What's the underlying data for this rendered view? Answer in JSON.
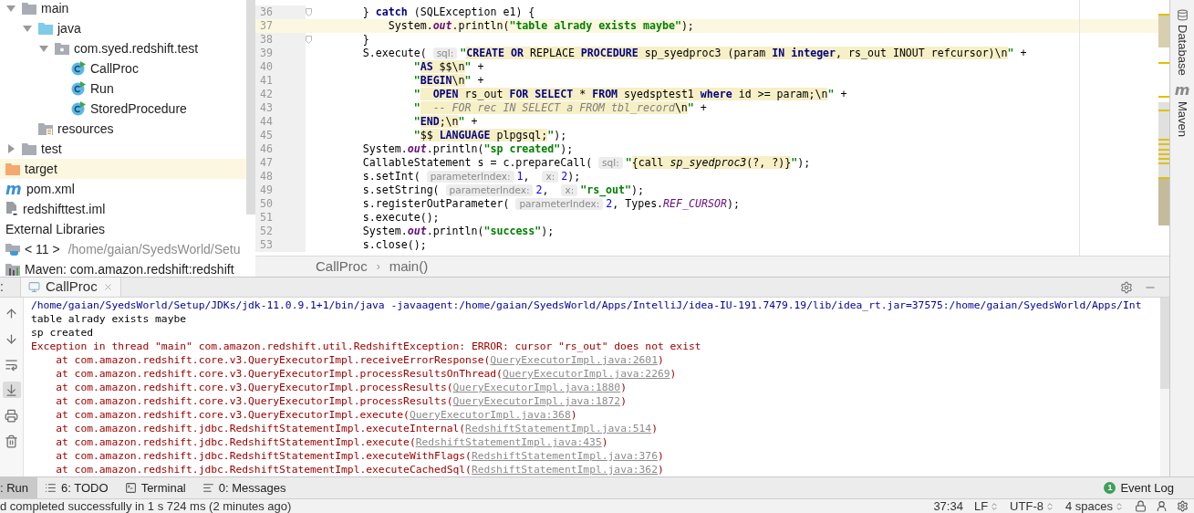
{
  "project_tree": [
    {
      "label": "main",
      "kind": "folder",
      "expanded": true,
      "selected": false,
      "children": [
        {
          "label": "java",
          "kind": "source_folder",
          "expanded": true,
          "selected": false,
          "children": [
            {
              "label": "com.syed.redshift.test",
              "kind": "package",
              "expanded": true,
              "selected": false,
              "children": [
                {
                  "label": "CallProc",
                  "kind": "class",
                  "selected": false
                },
                {
                  "label": "Run",
                  "kind": "class",
                  "selected": false
                },
                {
                  "label": "StoredProcedure",
                  "kind": "class",
                  "selected": false
                }
              ]
            }
          ]
        },
        {
          "label": "resources",
          "kind": "resources",
          "selected": false
        }
      ]
    },
    {
      "label": "test",
      "kind": "folder",
      "expanded": false,
      "selected": false
    },
    {
      "label": "target",
      "kind": "excluded_folder",
      "selected": true
    },
    {
      "label": "pom.xml",
      "kind": "maven_file",
      "glyph": "m",
      "selected": false
    },
    {
      "label": "redshifttest.iml",
      "kind": "module_file",
      "selected": false
    },
    {
      "label": "External Libraries",
      "kind": "libraries",
      "selected": false
    },
    {
      "label": "< 11 >",
      "detail": "/home/gaian/SyedsWorld/Setu",
      "kind": "jdk",
      "selected": false
    },
    {
      "label": "Maven: com.amazon.redshift:redshift",
      "kind": "library",
      "selected": false
    }
  ],
  "editor": {
    "lines": [
      {
        "number": "36",
        "fold": true,
        "current": false,
        "tokens": [
          {
            "kind": "p",
            "text": "        } "
          },
          {
            "kind": "kw",
            "text": "catch"
          },
          {
            "kind": "p",
            "text": " (SQLException e1) {"
          }
        ]
      },
      {
        "number": "37",
        "fold": false,
        "current": true,
        "tokens": [
          {
            "kind": "p",
            "text": "            System."
          },
          {
            "kind": "f",
            "text": "out"
          },
          {
            "kind": "p",
            "text": ".println("
          },
          {
            "kind": "s",
            "text": "\"table alrady exists maybe\""
          },
          {
            "kind": "p",
            "text": ");"
          }
        ]
      },
      {
        "number": "38",
        "fold": true,
        "current": false,
        "tokens": [
          {
            "kind": "p",
            "text": "        }"
          }
        ]
      },
      {
        "number": "39",
        "fold": false,
        "current": false,
        "tokens": [
          {
            "kind": "p",
            "text": "        S.execute( "
          },
          {
            "kind": "h",
            "text": "sql:"
          },
          {
            "kind": "s",
            "text": "\""
          },
          {
            "kind": "sk",
            "text": "CREATE OR"
          },
          {
            "kind": "st",
            "text": " REPLACE "
          },
          {
            "kind": "sk",
            "text": "PROCEDURE"
          },
          {
            "kind": "st",
            "text": " sp_syedproc3 (param "
          },
          {
            "kind": "sk",
            "text": "IN integer"
          },
          {
            "kind": "st",
            "text": ", rs_out INOUT refcursor)\\n"
          },
          {
            "kind": "s",
            "text": "\""
          },
          {
            "kind": "p",
            "text": " +"
          }
        ]
      },
      {
        "number": "40",
        "fold": false,
        "current": false,
        "tokens": [
          {
            "kind": "s",
            "text": "                \""
          },
          {
            "kind": "sk",
            "text": "AS"
          },
          {
            "kind": "st",
            "text": " $$\\n"
          },
          {
            "kind": "s",
            "text": "\""
          },
          {
            "kind": "p",
            "text": " +"
          }
        ]
      },
      {
        "number": "41",
        "fold": false,
        "current": false,
        "tokens": [
          {
            "kind": "s",
            "text": "                \""
          },
          {
            "kind": "sk",
            "text": "BEGIN"
          },
          {
            "kind": "st",
            "text": "\\n"
          },
          {
            "kind": "s",
            "text": "\""
          },
          {
            "kind": "p",
            "text": " +"
          }
        ]
      },
      {
        "number": "42",
        "fold": false,
        "current": false,
        "tokens": [
          {
            "kind": "s",
            "text": "                \""
          },
          {
            "kind": "sk",
            "text": "  OPEN"
          },
          {
            "kind": "st",
            "text": " rs_out "
          },
          {
            "kind": "sk",
            "text": "FOR SELECT"
          },
          {
            "kind": "st",
            "text": " * "
          },
          {
            "kind": "sk",
            "text": "FROM"
          },
          {
            "kind": "st",
            "text": " syedsptest1 "
          },
          {
            "kind": "sk",
            "text": "where"
          },
          {
            "kind": "st",
            "text": " id >= param;\\n"
          },
          {
            "kind": "s",
            "text": "\""
          },
          {
            "kind": "p",
            "text": " +"
          }
        ]
      },
      {
        "number": "43",
        "fold": false,
        "current": false,
        "tokens": [
          {
            "kind": "s",
            "text": "                \""
          },
          {
            "kind": "sc",
            "text": "  -- FOR rec IN SELECT a FROM tbl_record"
          },
          {
            "kind": "st",
            "text": "\\n"
          },
          {
            "kind": "s",
            "text": "\""
          },
          {
            "kind": "p",
            "text": " +"
          }
        ]
      },
      {
        "number": "44",
        "fold": false,
        "current": false,
        "tokens": [
          {
            "kind": "s",
            "text": "                \""
          },
          {
            "kind": "sk",
            "text": "END"
          },
          {
            "kind": "st",
            "text": ";\\n"
          },
          {
            "kind": "s",
            "text": "\""
          },
          {
            "kind": "p",
            "text": " +"
          }
        ]
      },
      {
        "number": "45",
        "fold": false,
        "current": false,
        "tokens": [
          {
            "kind": "s",
            "text": "                \""
          },
          {
            "kind": "st",
            "text": "$$ "
          },
          {
            "kind": "sk",
            "text": "LANGUAGE"
          },
          {
            "kind": "st",
            "text": " plpgsql;"
          },
          {
            "kind": "s",
            "text": "\""
          },
          {
            "kind": "p",
            "text": ");"
          }
        ]
      },
      {
        "number": "46",
        "fold": false,
        "current": false,
        "tokens": [
          {
            "kind": "p",
            "text": "        System."
          },
          {
            "kind": "f",
            "text": "out"
          },
          {
            "kind": "p",
            "text": ".println("
          },
          {
            "kind": "s",
            "text": "\"sp created\""
          },
          {
            "kind": "p",
            "text": ");"
          }
        ]
      },
      {
        "number": "47",
        "fold": false,
        "current": false,
        "tokens": [
          {
            "kind": "p",
            "text": "        CallableStatement s = c.prepareCall( "
          },
          {
            "kind": "h",
            "text": "sql:"
          },
          {
            "kind": "s",
            "text": "\""
          },
          {
            "kind": "st",
            "text": "{call "
          },
          {
            "kind": "si",
            "text": "sp_syedproc3"
          },
          {
            "kind": "st",
            "text": "(?, ?)}"
          },
          {
            "kind": "s",
            "text": "\""
          },
          {
            "kind": "p",
            "text": ");"
          }
        ]
      },
      {
        "number": "48",
        "fold": false,
        "current": false,
        "tokens": [
          {
            "kind": "p",
            "text": "        s.setInt( "
          },
          {
            "kind": "h",
            "text": "parameterIndex:"
          },
          {
            "kind": "n",
            "text": "1"
          },
          {
            "kind": "p",
            "text": ",  "
          },
          {
            "kind": "h",
            "text": "x:"
          },
          {
            "kind": "n",
            "text": "2"
          },
          {
            "kind": "p",
            "text": ");"
          }
        ]
      },
      {
        "number": "49",
        "fold": false,
        "current": false,
        "tokens": [
          {
            "kind": "p",
            "text": "        s.setString( "
          },
          {
            "kind": "h",
            "text": "parameterIndex:"
          },
          {
            "kind": "n",
            "text": "2"
          },
          {
            "kind": "p",
            "text": ",  "
          },
          {
            "kind": "h",
            "text": "x:"
          },
          {
            "kind": "s",
            "text": "\"rs_out\""
          },
          {
            "kind": "p",
            "text": ");"
          }
        ]
      },
      {
        "number": "50",
        "fold": false,
        "current": false,
        "tokens": [
          {
            "kind": "p",
            "text": "        s.registerOutParameter( "
          },
          {
            "kind": "h",
            "text": "parameterIndex:"
          },
          {
            "kind": "n",
            "text": "2"
          },
          {
            "kind": "p",
            "text": ", Types."
          },
          {
            "kind": "c",
            "text": "REF_CURSOR"
          },
          {
            "kind": "p",
            "text": ");"
          }
        ]
      },
      {
        "number": "51",
        "fold": false,
        "current": false,
        "tokens": [
          {
            "kind": "p",
            "text": "        s.execute();"
          }
        ]
      },
      {
        "number": "52",
        "fold": false,
        "current": false,
        "tokens": [
          {
            "kind": "p",
            "text": "        System."
          },
          {
            "kind": "f",
            "text": "out"
          },
          {
            "kind": "p",
            "text": ".println("
          },
          {
            "kind": "s",
            "text": "\"success\""
          },
          {
            "kind": "p",
            "text": ");"
          }
        ]
      },
      {
        "number": "53",
        "fold": false,
        "current": false,
        "tokens": [
          {
            "kind": "p",
            "text": "        s.close();"
          }
        ]
      }
    ],
    "breadcrumbs": [
      "CallProc",
      "main()"
    ],
    "breadcrumb_separator": "›"
  },
  "right_toolbar": [
    {
      "label": "Database",
      "kind": "database"
    },
    {
      "label": "Maven",
      "kind": "maven",
      "glyph": "m"
    }
  ],
  "run_panel": {
    "label": ":",
    "tabs": [
      {
        "label": "CallProc",
        "selected": true
      }
    ],
    "toolbar": [
      {
        "kind": "up",
        "selected": false
      },
      {
        "kind": "down",
        "selected": false
      },
      {
        "kind": "wrap",
        "selected": false
      },
      {
        "kind": "scroll_end",
        "selected": true
      },
      {
        "kind": "print",
        "selected": false
      },
      {
        "kind": "trash",
        "selected": false
      }
    ],
    "console": [
      {
        "kind": "command",
        "text": "/home/gaian/SyedsWorld/Setup/JDKs/jdk-11.0.9.1+1/bin/java -javaagent:/home/gaian/SyedsWorld/Apps/IntelliJ/idea-IU-191.7479.19/lib/idea_rt.jar=37575:/home/gaian/SyedsWorld/Apps/Int"
      },
      {
        "kind": "out",
        "text": "table alrady exists maybe"
      },
      {
        "kind": "out",
        "text": "sp created"
      },
      {
        "kind": "error",
        "text": "Exception in thread \"main\" com.amazon.redshift.util.RedshiftException: ERROR: cursor \"rs_out\" does not exist"
      },
      {
        "kind": "trace",
        "text": "    at com.amazon.redshift.core.v3.QueryExecutorImpl.receiveErrorResponse(",
        "link": "QueryExecutorImpl.java:2601",
        "end": ")"
      },
      {
        "kind": "trace",
        "text": "    at com.amazon.redshift.core.v3.QueryExecutorImpl.processResultsOnThread(",
        "link": "QueryExecutorImpl.java:2269",
        "end": ")"
      },
      {
        "kind": "trace",
        "text": "    at com.amazon.redshift.core.v3.QueryExecutorImpl.processResults(",
        "link": "QueryExecutorImpl.java:1880",
        "end": ")"
      },
      {
        "kind": "trace",
        "text": "    at com.amazon.redshift.core.v3.QueryExecutorImpl.processResults(",
        "link": "QueryExecutorImpl.java:1872",
        "end": ")"
      },
      {
        "kind": "trace",
        "text": "    at com.amazon.redshift.core.v3.QueryExecutorImpl.execute(",
        "link": "QueryExecutorImpl.java:368",
        "end": ")"
      },
      {
        "kind": "trace",
        "text": "    at com.amazon.redshift.jdbc.RedshiftStatementImpl.executeInternal(",
        "link": "RedshiftStatementImpl.java:514",
        "end": ")"
      },
      {
        "kind": "trace",
        "text": "    at com.amazon.redshift.jdbc.RedshiftStatementImpl.execute(",
        "link": "RedshiftStatementImpl.java:435",
        "end": ")"
      },
      {
        "kind": "trace",
        "text": "    at com.amazon.redshift.jdbc.RedshiftStatementImpl.executeWithFlags(",
        "link": "RedshiftStatementImpl.java:376",
        "end": ")"
      },
      {
        "kind": "trace",
        "text": "    at com.amazon.redshift.jdbc.RedshiftStatementImpl.executeCachedSql(",
        "link": "RedshiftStatementImpl.java:362",
        "end": ")"
      }
    ]
  },
  "bottom_toolbar": {
    "left": [
      {
        "label": ": Run",
        "kind": "run",
        "selected": true
      },
      {
        "label": "6: TODO",
        "kind": "todo",
        "selected": false
      },
      {
        "label": "Terminal",
        "kind": "terminal",
        "selected": false
      },
      {
        "label": "0: Messages",
        "kind": "messages",
        "selected": false
      }
    ],
    "right": [
      {
        "label": "Event Log",
        "badge": "1"
      }
    ]
  },
  "status_bar": {
    "message": "d completed successfully in 1 s 724 ms (2 minutes ago)",
    "items": [
      {
        "label": "37:34",
        "kind": "text"
      },
      {
        "label": "LF",
        "kind": "selector"
      },
      {
        "label": "UTF-8",
        "kind": "selector"
      },
      {
        "label": "4 spaces",
        "kind": "selector"
      }
    ],
    "icons": [
      {
        "kind": "lock"
      },
      {
        "kind": "inspector"
      },
      {
        "kind": "settings"
      }
    ]
  }
}
